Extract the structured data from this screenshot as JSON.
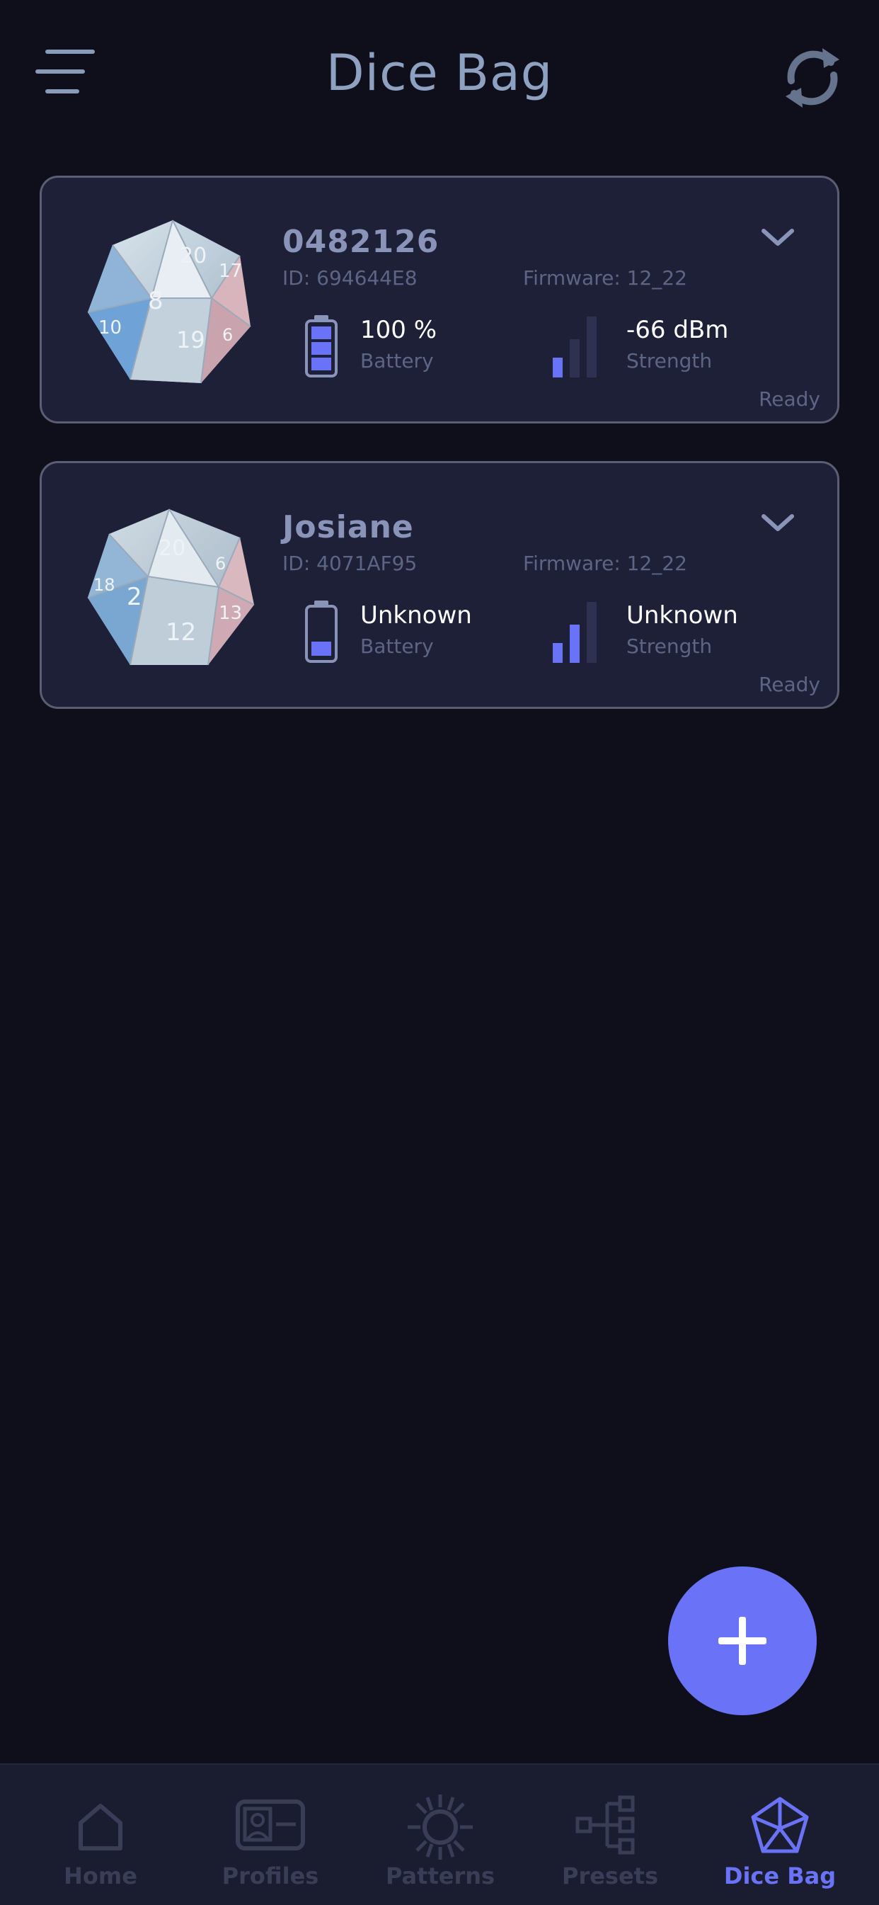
{
  "header": {
    "title": "Dice Bag",
    "menu_icon": "menu-icon",
    "refresh_icon": "refresh-icon"
  },
  "dice": [
    {
      "name": "0482126",
      "id": "ID: 694644E8",
      "firmware": "Firmware: 12_22",
      "battery_value": "100 %",
      "battery_label": "Battery",
      "battery_level": 1.0,
      "signal_value": "-66 dBm",
      "signal_label": "Strength",
      "signal_bars": 1,
      "status": "Ready",
      "face_numbers": [
        "20",
        "8",
        "17",
        "19",
        "10",
        "6"
      ]
    },
    {
      "name": "Josiane",
      "id": "ID: 4071AF95",
      "firmware": "Firmware: 12_22",
      "battery_value": "Unknown",
      "battery_label": "Battery",
      "battery_level": 0.33,
      "signal_value": "Unknown",
      "signal_label": "Strength",
      "signal_bars": 2,
      "status": "Ready",
      "face_numbers": [
        "20",
        "2",
        "12",
        "6",
        "18",
        "13"
      ]
    }
  ],
  "fab": {
    "icon": "plus-icon"
  },
  "nav": {
    "items": [
      {
        "label": "Home",
        "icon": "home-icon"
      },
      {
        "label": "Profiles",
        "icon": "profile-card-icon"
      },
      {
        "label": "Patterns",
        "icon": "patterns-sun-icon"
      },
      {
        "label": "Presets",
        "icon": "presets-tree-icon"
      },
      {
        "label": "Dice Bag",
        "icon": "dice-icon"
      }
    ],
    "active_index": 4
  },
  "colors": {
    "background": "#0f0f1c",
    "card": "#1e2038",
    "accent": "#6a72f7",
    "muted_text": "#5d6584",
    "title_text": "#8fa1c0"
  }
}
